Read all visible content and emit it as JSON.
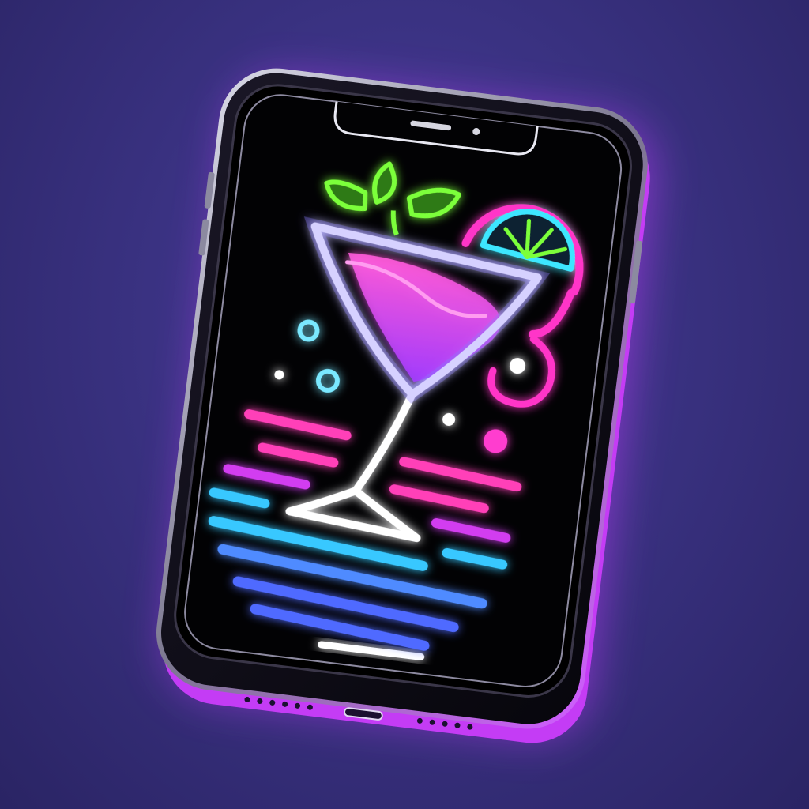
{
  "scene": {
    "subject": "phone-icon",
    "screen_icon": "cocktail-glass-icon",
    "garnish_icons": [
      "mint-leaves-icon",
      "lime-slice-icon"
    ]
  },
  "colors": {
    "background": "#3a3282",
    "phone_body": "#0b0b12",
    "phone_rim": "#c9c9d6",
    "phone_glow": "#c23bff",
    "glass_outline": "#ffffff",
    "glass_glow": "#8a7bff",
    "drink": "#e23ce0",
    "leaf": "#7cff3a",
    "lime_rind": "#ff35c8",
    "lime_fruit": "#3ee6ff",
    "line_pink": "#ff3fb8",
    "line_magenta": "#d23cf0",
    "line_cyan": "#37c8ff",
    "line_blue": "#4f6bff",
    "bubble_cyan": "#7ae8ff",
    "bubble_pink": "#ff3ccf"
  }
}
